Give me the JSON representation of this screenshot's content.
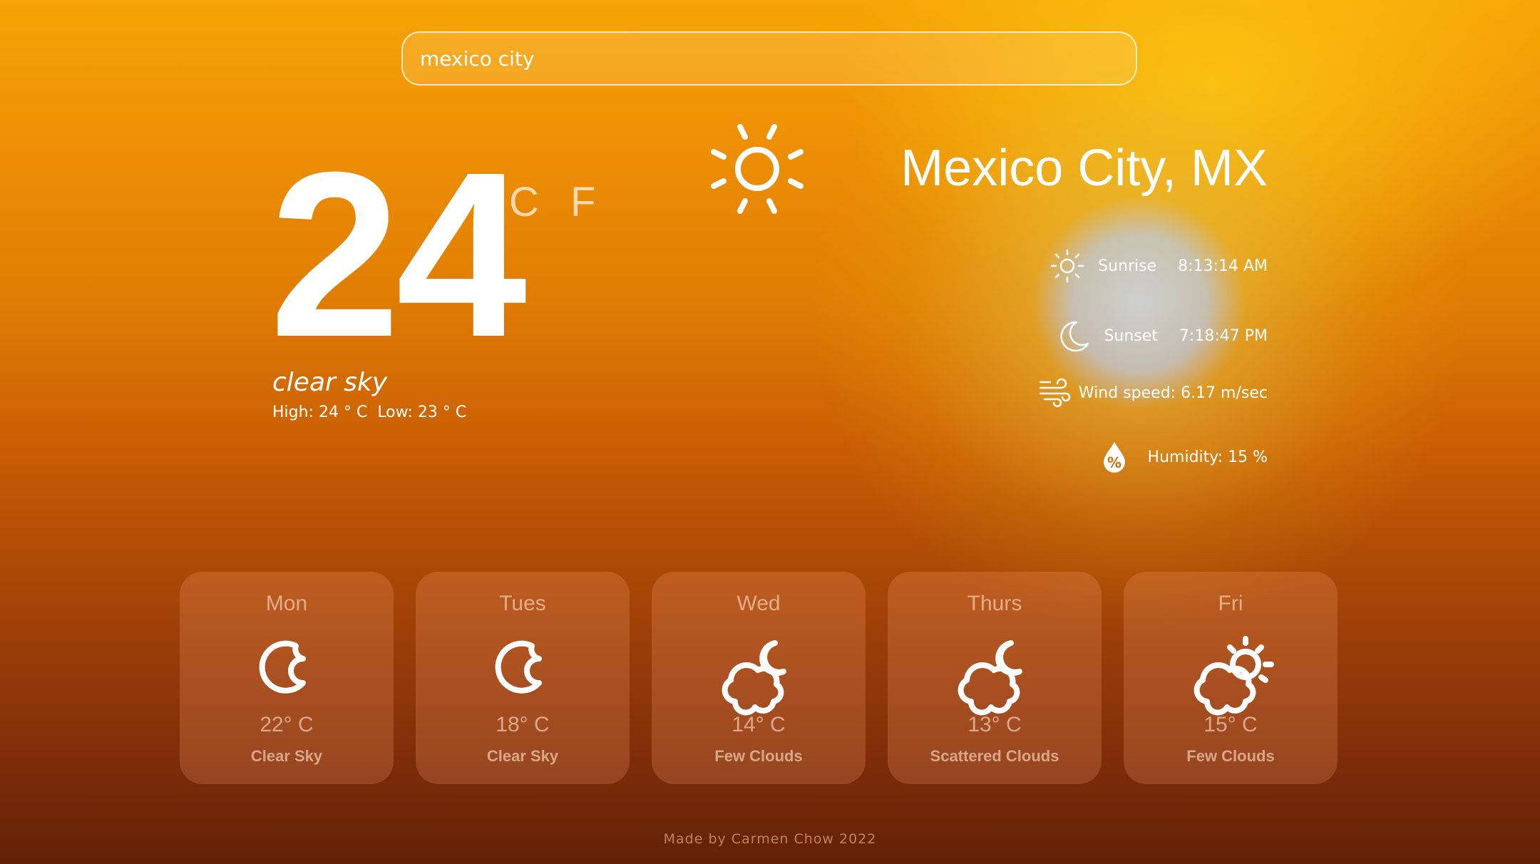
{
  "search": {
    "value": "mexico city",
    "placeholder": ""
  },
  "current": {
    "temp": "24",
    "unit_c": "C",
    "unit_f": "F",
    "description": "clear sky",
    "high": "High: 24 ° C",
    "low": "Low: 23 ° C",
    "icon": "sun-icon"
  },
  "location": {
    "city": "Mexico City, MX"
  },
  "stats": {
    "sunrise": {
      "label": "Sunrise",
      "value": "8:13:14 AM",
      "icon": "sunrise-icon"
    },
    "sunset": {
      "label": "Sunset",
      "value": "7:18:47 PM",
      "icon": "moon-icon"
    },
    "wind": {
      "text": "Wind speed: 6.17 m/sec",
      "icon": "wind-icon"
    },
    "humidity": {
      "text": "Humidity: 15 %",
      "icon": "humidity-drop-icon"
    }
  },
  "forecast": [
    {
      "day": "Mon",
      "temp": "22° C",
      "desc": "Clear Sky",
      "icon": "moon-clear-icon"
    },
    {
      "day": "Tues",
      "temp": "18° C",
      "desc": "Clear Sky",
      "icon": "moon-clear-icon"
    },
    {
      "day": "Wed",
      "temp": "14° C",
      "desc": "Few Clouds",
      "icon": "cloud-moon-icon"
    },
    {
      "day": "Thurs",
      "temp": "13° C",
      "desc": "Scattered Clouds",
      "icon": "cloud-moon-icon"
    },
    {
      "day": "Fri",
      "temp": "15° C",
      "desc": "Few Clouds",
      "icon": "cloud-sun-icon"
    }
  ],
  "footer": {
    "text": "Made by Carmen Chow 2022"
  },
  "colors": {
    "accent": "#f7a406",
    "text": "#ffffff"
  }
}
